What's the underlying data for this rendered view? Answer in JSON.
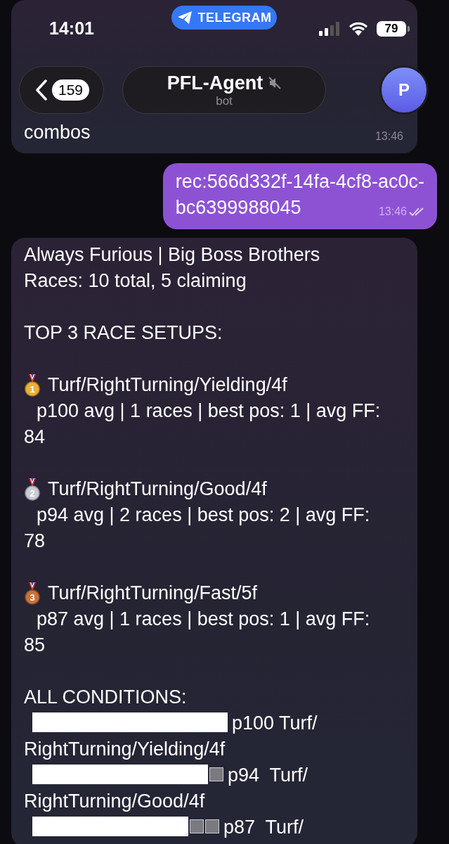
{
  "status_bar": {
    "time": "14:01",
    "app_pill": "TELEGRAM",
    "battery": "79"
  },
  "header": {
    "back_count": "159",
    "title": "PFL-Agent",
    "muted": true,
    "subtitle": "bot",
    "avatar_letter": "P"
  },
  "messages": [
    {
      "kind": "incoming",
      "text": "combos",
      "time": "13:46"
    },
    {
      "kind": "outgoing",
      "lines": [
        "rec:566d332f-14fa-4cf8-ac0c-",
        "bc6399988045"
      ],
      "time": "13:46",
      "read": true
    },
    {
      "kind": "report",
      "title": "Always Furious | Big Boss Brothers",
      "races": "Races: 10 total, 5 claiming",
      "setups_heading": "TOP 3 RACE SETUPS:",
      "setups": [
        {
          "kind": "gold",
          "rank": "1",
          "setup": "Turf/RightTurning/Yielding/4f",
          "stats": "p100 avg | 1 races | best pos: 1 | avg FF: 84"
        },
        {
          "kind": "silver",
          "rank": "2",
          "setup": "Turf/RightTurning/Good/4f",
          "stats": "p94 avg | 2 races | best pos: 2 | avg FF: 78"
        },
        {
          "kind": "bronze",
          "rank": "3",
          "setup": "Turf/RightTurning/Fast/5f",
          "stats": "p87 avg | 1 races | best pos: 1 | avg FF: 85"
        }
      ],
      "conditions_heading": "ALL CONDITIONS:",
      "conditions": [
        {
          "segments": [
            {
              "kind": "redacted"
            }
          ],
          "text": "p100 Turf/",
          "wrap": "RightTurning/Yielding/4f"
        },
        {
          "segments": [
            {
              "kind": "redacted"
            },
            {
              "kind": "empty"
            }
          ],
          "text": "p94  Turf/",
          "wrap": "RightTurning/Good/4f"
        },
        {
          "segments": [
            {
              "kind": "redacted"
            },
            {
              "kind": "empty"
            },
            {
              "kind": "empty"
            }
          ],
          "text": "p87  Turf/"
        }
      ]
    }
  ]
}
